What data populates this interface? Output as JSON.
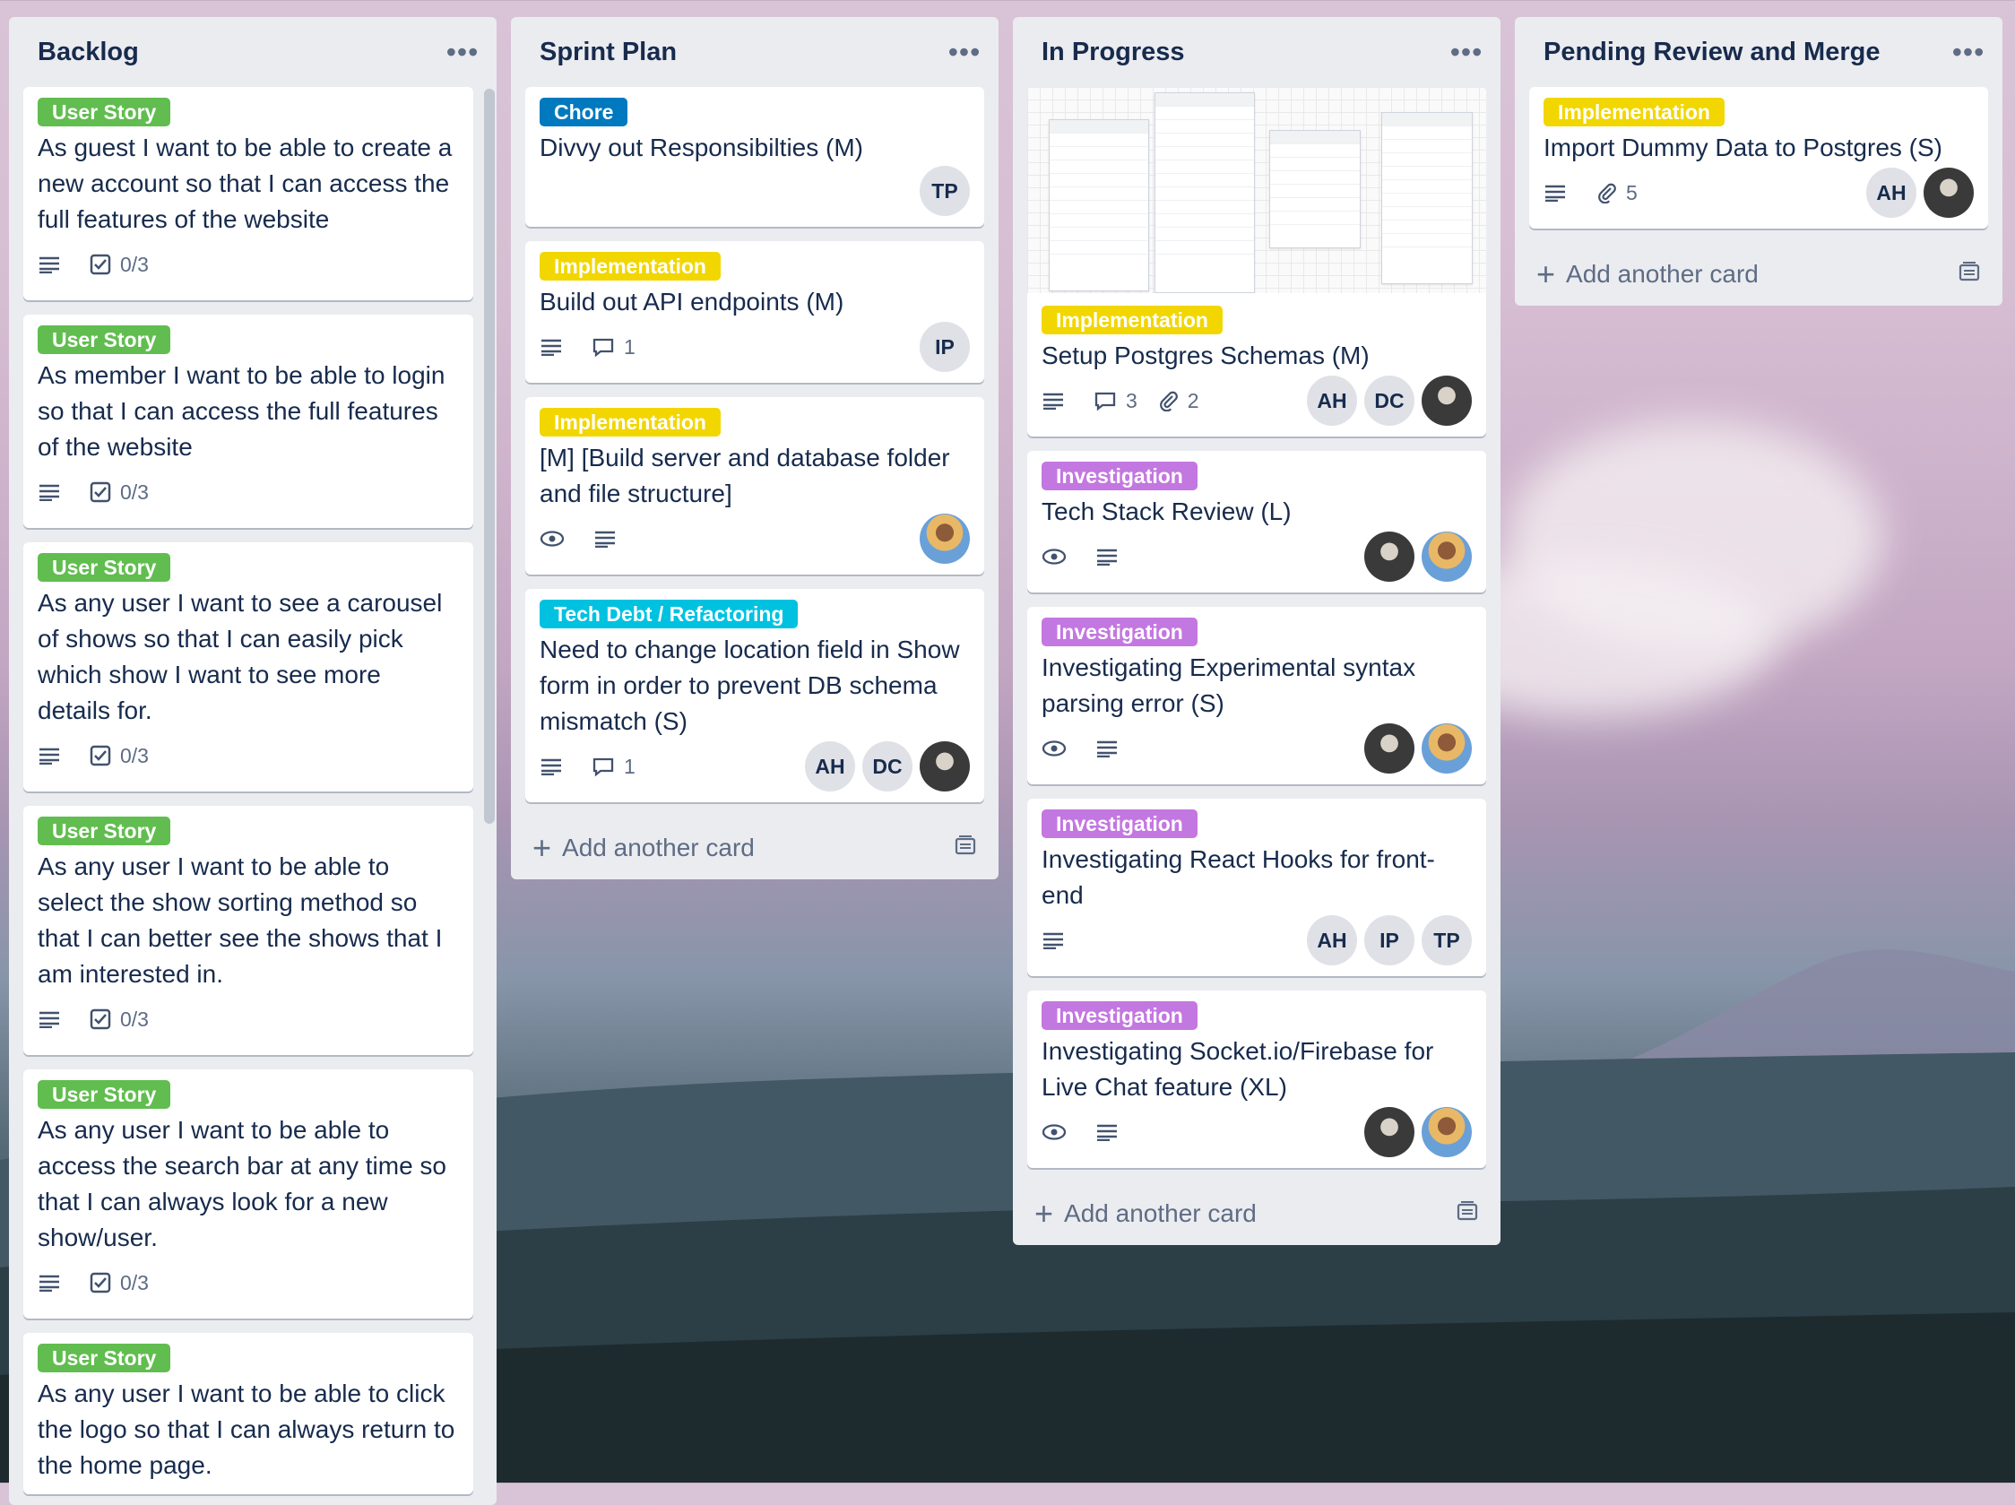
{
  "lists": [
    {
      "title": "Backlog",
      "cards": [
        {
          "label": "User Story",
          "title": "As guest I want to be able to create a new account so that I can access the full features of the website",
          "checklist": "0/3"
        },
        {
          "label": "User Story",
          "title": "As member I want to be able to login so that I can access the full features of the website",
          "checklist": "0/3"
        },
        {
          "label": "User Story",
          "title": "As any user I want to see a carousel of shows so that I can easily pick which show I want to see more details for.",
          "checklist": "0/3"
        },
        {
          "label": "User Story",
          "title": "As any user I want to be able to select the show sorting method so that I can better see the shows that I am interested in.",
          "checklist": "0/3"
        },
        {
          "label": "User Story",
          "title": "As any user I want to be able to access the search bar at any time so that I can always look for a new show/user.",
          "checklist": "0/3"
        },
        {
          "label": "User Story",
          "title": "As any user I want to be able to click the logo so that I can always return to the home page."
        }
      ]
    },
    {
      "title": "Sprint Plan",
      "add_card": "Add another card",
      "cards": [
        {
          "label": "Chore",
          "title": "Divvy out Responsibilties (M)",
          "members": [
            "TP"
          ]
        },
        {
          "label": "Implementation",
          "title": "Build out API endpoints (M)",
          "comments": "1",
          "members": [
            "IP"
          ]
        },
        {
          "label": "Implementation",
          "title": "[M] [Build server and database folder and file structure]"
        },
        {
          "label": "Tech Debt / Refactoring",
          "title": "Need to change location field in Show form in order to prevent DB schema mismatch (S)",
          "comments": "1",
          "members": [
            "AH",
            "DC"
          ]
        }
      ]
    },
    {
      "title": "In Progress",
      "add_card": "Add another card",
      "cards": [
        {
          "label": "Implementation",
          "title": "Setup Postgres Schemas (M)",
          "comments": "3",
          "attachments": "2",
          "members": [
            "AH",
            "DC"
          ]
        },
        {
          "label": "Investigation",
          "title": "Tech Stack Review (L)"
        },
        {
          "label": "Investigation",
          "title": "Investigating Experimental syntax parsing error (S)"
        },
        {
          "label": "Investigation",
          "title": "Investigating React Hooks for front-end",
          "members": [
            "AH",
            "IP",
            "TP"
          ]
        },
        {
          "label": "Investigation",
          "title": "Investigating Socket.io/Firebase for Live Chat feature (XL)"
        }
      ]
    },
    {
      "title": "Pending Review and Merge",
      "add_card": "Add another card",
      "cards": [
        {
          "label": "Implementation",
          "title": "Import Dummy Data to Postgres (S)",
          "attachments": "5",
          "members": [
            "AH"
          ]
        }
      ]
    }
  ],
  "icons": {
    "menu": "more-horizontal-icon",
    "description": "description-icon",
    "checklist": "checklist-icon",
    "comment": "comment-icon",
    "attachment": "paperclip-icon",
    "watch": "eye-icon",
    "template": "card-template-icon",
    "add": "plus-icon"
  },
  "schema_preview": {
    "tables": [
      "public users",
      "public shows",
      "public comments",
      "public reviews"
    ]
  },
  "colors": {
    "label_green": "#61bd4f",
    "label_yellow": "#f2d600",
    "label_blue": "#0079bf",
    "label_sky": "#00c2e0",
    "label_purple": "#c377e0",
    "list_bg": "#ebecf0"
  }
}
